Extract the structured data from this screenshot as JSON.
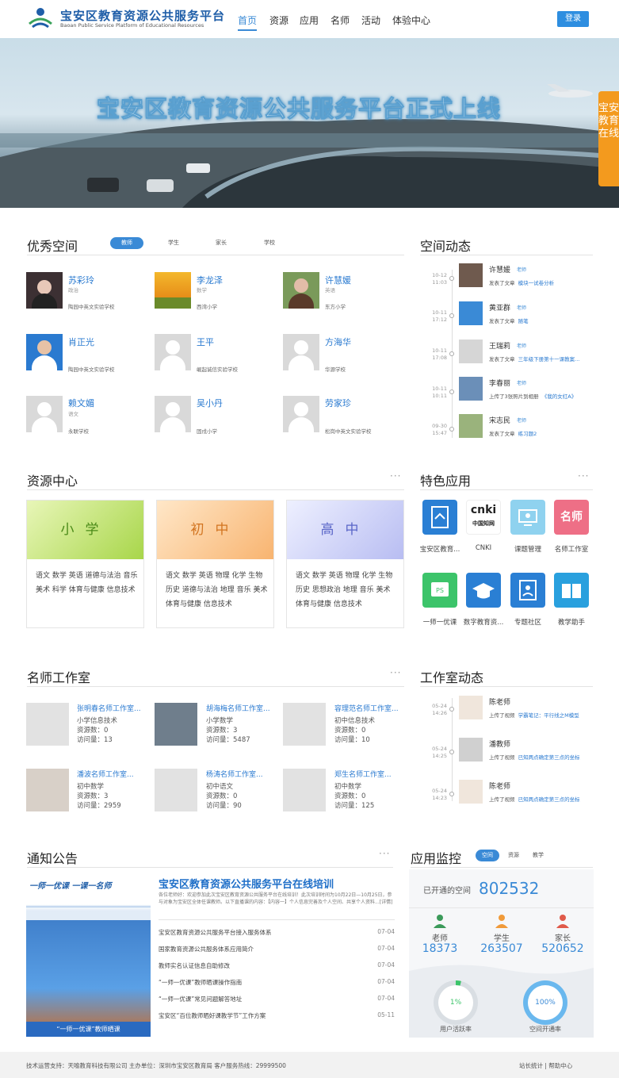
{
  "header": {
    "logo_cn": "宝安区教育资源公共服务平台",
    "logo_en": "Baoan Public Service Platform of Educational Resources",
    "nav": [
      "首页",
      "资源",
      "应用",
      "名师",
      "活动",
      "体验中心"
    ],
    "login": "登录"
  },
  "banner": {
    "title": "宝安区教育资源公共服务平台正式上线",
    "side_button": "宝安教育在线"
  },
  "spaces": {
    "title": "优秀空间",
    "tabs": [
      "教师",
      "学生",
      "家长",
      "学校"
    ],
    "teachers": [
      {
        "name": "苏彩玲",
        "sub": "政治",
        "school": "陶园中英文实验学校"
      },
      {
        "name": "李龙泽",
        "sub": "数学",
        "school": "西湾小学"
      },
      {
        "name": "许慧媛",
        "sub": "英语",
        "school": "东方小学"
      },
      {
        "name": "肖正光",
        "sub": "",
        "school": "陶园中英文实验学校"
      },
      {
        "name": "王平",
        "sub": "",
        "school": "崛起诚信实验学校"
      },
      {
        "name": "方海华",
        "sub": "",
        "school": "华源学校"
      },
      {
        "name": "赖文媚",
        "sub": "语文",
        "school": "永联学校"
      },
      {
        "name": "吴小丹",
        "sub": "",
        "school": "固戍小学"
      },
      {
        "name": "劳家珍",
        "sub": "",
        "school": "松岗中英文实验学校"
      }
    ]
  },
  "activity": {
    "title": "空间动态",
    "items": [
      {
        "date": "10-12",
        "time": "11:03",
        "name": "许慧媛",
        "tag": "老师",
        "action": "发表了文章",
        "object": "模块一试卷分析"
      },
      {
        "date": "10-11",
        "time": "17:12",
        "name": "黄亚群",
        "tag": "老师",
        "action": "发表了文章",
        "object": "随笔"
      },
      {
        "date": "10-11",
        "time": "17:08",
        "name": "王瑞莉",
        "tag": "老师",
        "action": "发表了文章",
        "object": "三年级下册第十一课教案..."
      },
      {
        "date": "10-11",
        "time": "10:11",
        "name": "李春丽",
        "tag": "老师",
        "action": "上传了3张照片到相册",
        "object": "《我的女红A》"
      },
      {
        "date": "09-30",
        "time": "15:47",
        "name": "宋志民",
        "tag": "老师",
        "action": "发表了文章",
        "object": "练习题2"
      }
    ]
  },
  "resources": {
    "title": "资源中心",
    "more": "···",
    "cards": [
      {
        "title": "小学",
        "subjects": "语文 数学 英语 道德与法治 音乐 美术 科学 体育与健康 信息技术"
      },
      {
        "title": "初中",
        "subjects": "语文 数学 英语 物理 化学 生物 历史 道德与法治 地理 音乐 美术 体育与健康 信息技术"
      },
      {
        "title": "高中",
        "subjects": "语文 数学 英语 物理 化学 生物 历史 思想政治 地理 音乐 美术 体育与健康 信息技术"
      }
    ]
  },
  "apps": {
    "title": "特色应用",
    "more": "···",
    "items": [
      {
        "label": "宝安区教育...",
        "icon": "book-doc-icon",
        "color": "#2a7fd4"
      },
      {
        "label": "CNKI",
        "icon": "cnki-logo-icon",
        "color": "#ffffff"
      },
      {
        "label": "课题管理",
        "icon": "monitor-icon",
        "color": "#8fd2ef"
      },
      {
        "label": "名师工作室",
        "icon": "mingshi-icon",
        "color": "#ee6f86",
        "glyph": "名师"
      },
      {
        "label": "一师一优课",
        "icon": "course-icon",
        "color": "#3cc46a"
      },
      {
        "label": "数字教育资...",
        "icon": "graduation-cap-icon",
        "color": "#2a7fd4"
      },
      {
        "label": "专题社区",
        "icon": "community-icon",
        "color": "#2a7fd4"
      },
      {
        "label": "教学助手",
        "icon": "open-book-icon",
        "color": "#29a0de"
      }
    ]
  },
  "studios": {
    "title": "名师工作室",
    "more": "···",
    "items": [
      {
        "name": "张明春名师工作室...",
        "subject": "小学信息技术",
        "resources": "资源数：0",
        "visits": "访问量：13"
      },
      {
        "name": "胡海梅名师工作室...",
        "subject": "小学数学",
        "resources": "资源数：3",
        "visits": "访问量：5487"
      },
      {
        "name": "容理范名师工作室...",
        "subject": "初中信息技术",
        "resources": "资源数：0",
        "visits": "访问量：10"
      },
      {
        "name": "潘波名师工作室...",
        "subject": "初中数学",
        "resources": "资源数：3",
        "visits": "访问量：2959"
      },
      {
        "name": "杨涛名师工作室...",
        "subject": "初中语文",
        "resources": "资源数：0",
        "visits": "访问量：90"
      },
      {
        "name": "郑生名师工作室...",
        "subject": "初中数学",
        "resources": "资源数：0",
        "visits": "访问量：125"
      }
    ]
  },
  "studio_activity": {
    "title": "工作室动态",
    "items": [
      {
        "date": "05-24",
        "time": "14:26",
        "name": "陈老师",
        "action": "上传了视频",
        "object": "学霸笔记：平行线之M模型"
      },
      {
        "date": "05-24",
        "time": "14:25",
        "name": "潘教师",
        "action": "上传了视频",
        "object": "已知两点确定第三点的坐标"
      },
      {
        "date": "05-24",
        "time": "14:23",
        "name": "陈老师",
        "action": "上传了视频",
        "object": "已知两点确定第三点的坐标"
      }
    ]
  },
  "notices": {
    "title": "通知公告",
    "more": "···",
    "featured_title": "宝安区教育资源公共服务平台在线培训",
    "featured_desc": "各位老师好：欢迎参加此次宝安区教育资源公共服务平台在线培训！此次培训时间为10月22日—10月25日，参与对象为宝安区全体任课教师。以下直播课的内容：【内容一】个人信息完善及个人空间、共享个人资料...[详情]",
    "banner_text": "一师一优课 一课一名师",
    "banner_caption": "“一师一优课”教师晒课",
    "items": [
      {
        "text": "宝安区教育资源公共服务平台接入服务体系",
        "date": "07-04"
      },
      {
        "text": "国家教育资源公共服务体系应用简介",
        "date": "07-04"
      },
      {
        "text": "教师实名认证信息自助修改",
        "date": "07-04"
      },
      {
        "text": "“一师一优课”教师晒课操作指南",
        "date": "07-04"
      },
      {
        "text": "“一师一优课”常见问题解答地址",
        "date": "07-04"
      },
      {
        "text": "宝安区“百位教师晒好课教学节”工作方案",
        "date": "05-11"
      }
    ]
  },
  "monitor": {
    "title": "应用监控",
    "tabs": [
      "空间",
      "资源",
      "教学"
    ],
    "opened_label": "已开通的空间",
    "opened_value": "802532",
    "stats": [
      {
        "label": "老师",
        "value": "18373",
        "icon": "teacher-icon"
      },
      {
        "label": "学生",
        "value": "263507",
        "icon": "student-icon"
      },
      {
        "label": "家长",
        "value": "520652",
        "icon": "parent-icon"
      }
    ],
    "rings": [
      {
        "value": "1%",
        "label": "用户活跃率",
        "fraction": 0.01
      },
      {
        "value": "100%",
        "label": "空间开通率",
        "fraction": 1.0
      }
    ]
  },
  "footer": {
    "text": "技术运营支持：天喻教育科技有限公司 主办单位：深圳市宝安区教育局    客户服务热线：29999500",
    "right": "站长统计 | 帮助中心"
  }
}
